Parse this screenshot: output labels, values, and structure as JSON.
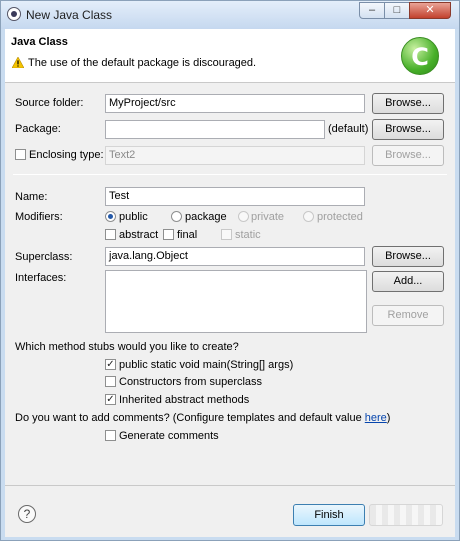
{
  "window": {
    "title": "New Java Class",
    "controls": {
      "minimize": "–",
      "maximize": "□",
      "close": "✕"
    }
  },
  "header": {
    "title": "Java Class",
    "message": "The use of the default package is discouraged.",
    "class_icon_letter": "C",
    "warning_icon": "warning-triangle",
    "accent_color": "#48b02a"
  },
  "form": {
    "source_folder": {
      "label": "Source folder:",
      "value": "MyProject/src",
      "browse": "Browse..."
    },
    "package": {
      "label": "Package:",
      "value": "",
      "hint": "(default)",
      "browse": "Browse..."
    },
    "enclosing_type": {
      "label": "Enclosing type:",
      "value": "Text2",
      "browse": "Browse...",
      "checked": false
    },
    "name": {
      "label": "Name:",
      "value": "Test"
    },
    "modifiers": {
      "label": "Modifiers:",
      "radios": [
        "public",
        "package",
        "private",
        "protected"
      ],
      "selected": "public",
      "checks": [
        "abstract",
        "final",
        "static"
      ]
    },
    "superclass": {
      "label": "Superclass:",
      "value": "java.lang.Object",
      "browse": "Browse..."
    },
    "interfaces": {
      "label": "Interfaces:",
      "add": "Add...",
      "remove": "Remove"
    },
    "stubs": {
      "question": "Which method stubs would you like to create?",
      "options": [
        {
          "label": "public static void main(String[] args)",
          "checked": true
        },
        {
          "label": "Constructors from superclass",
          "checked": false
        },
        {
          "label": "Inherited abstract methods",
          "checked": true
        }
      ]
    },
    "comments": {
      "question": "Do you want to add comments? (Configure templates and default value ",
      "link": "here",
      "question_end": ")",
      "option": "Generate comments",
      "checked": false
    }
  },
  "footer": {
    "help": "?",
    "finish": "Finish"
  }
}
